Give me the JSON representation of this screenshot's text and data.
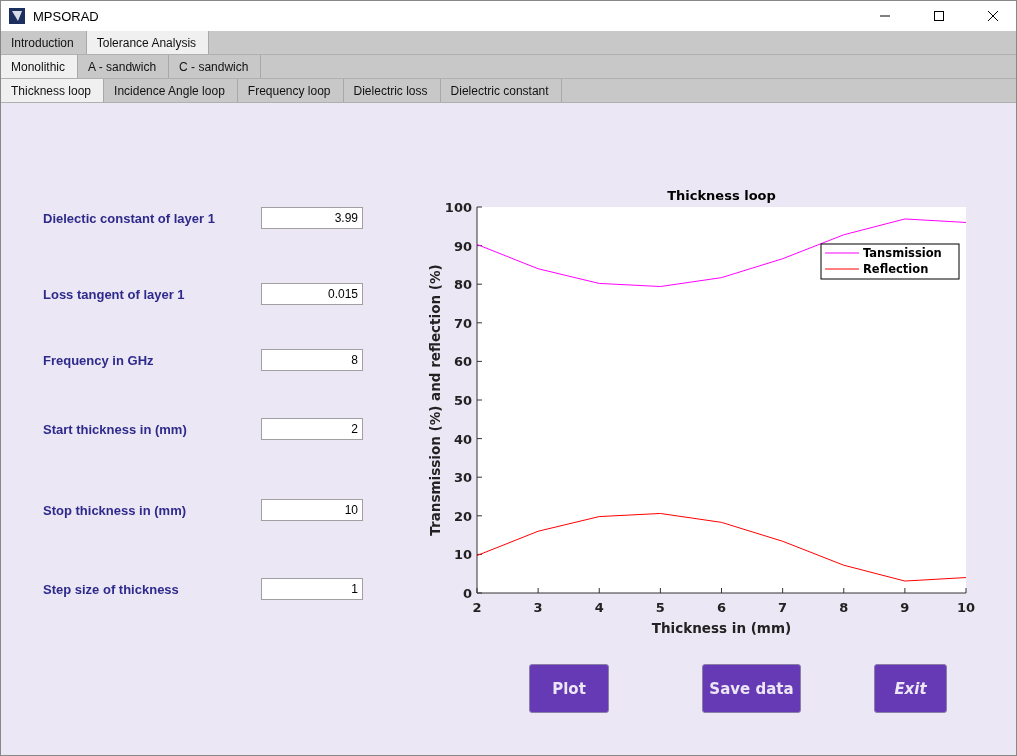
{
  "window": {
    "title": "MPSORAD"
  },
  "tab_rows": [
    {
      "tabs": [
        {
          "label": "Introduction",
          "selected": false
        },
        {
          "label": "Tolerance Analysis",
          "selected": true
        }
      ]
    },
    {
      "tabs": [
        {
          "label": "Monolithic",
          "selected": true
        },
        {
          "label": "A - sandwich",
          "selected": false
        },
        {
          "label": "C - sandwich",
          "selected": false
        }
      ]
    },
    {
      "tabs": [
        {
          "label": "Thickness loop",
          "selected": true
        },
        {
          "label": "Incidence Angle loop",
          "selected": false
        },
        {
          "label": "Frequency loop",
          "selected": false
        },
        {
          "label": "Dielectric loss",
          "selected": false
        },
        {
          "label": "Dielectric constant",
          "selected": false
        }
      ]
    }
  ],
  "fields": [
    {
      "label": "Dielectic constant of layer 1",
      "value": "3.99"
    },
    {
      "label": "Loss tangent of layer 1",
      "value": "0.015"
    },
    {
      "label": "Frequency in GHz",
      "value": "8"
    },
    {
      "label": "Start thickness in (mm)",
      "value": "2"
    },
    {
      "label": "Stop thickness in (mm)",
      "value": "10"
    },
    {
      "label": "Step size of thickness",
      "value": "1"
    }
  ],
  "chart_data": {
    "type": "line",
    "legend": true,
    "title": "Thickness loop",
    "xlabel": "Thickness in (mm)",
    "ylabel": "Transmission (%) and reflection (%)",
    "x": [
      2,
      3,
      4,
      5,
      6,
      7,
      8,
      9,
      10
    ],
    "xlim": [
      2,
      10
    ],
    "ylim": [
      0,
      100
    ],
    "xticks": [
      2,
      3,
      4,
      5,
      6,
      7,
      8,
      9,
      10
    ],
    "yticks": [
      0,
      10,
      20,
      30,
      40,
      50,
      60,
      70,
      80,
      90,
      100
    ],
    "series": [
      {
        "name": "Tansmission",
        "color": "#ff00ff",
        "values": [
          90.3,
          84,
          80.2,
          79.4,
          81.7,
          86.6,
          92.8,
          96.9,
          96
        ]
      },
      {
        "name": "Reflection",
        "color": "#ff0000",
        "values": [
          9.7,
          16,
          19.8,
          20.6,
          18.3,
          13.4,
          7.2,
          3.1,
          4
        ]
      }
    ]
  },
  "buttons": [
    {
      "label": "Plot",
      "kind": "normal"
    },
    {
      "label": "Save data",
      "kind": "normal"
    },
    {
      "label": "Exit",
      "kind": "italic"
    }
  ]
}
